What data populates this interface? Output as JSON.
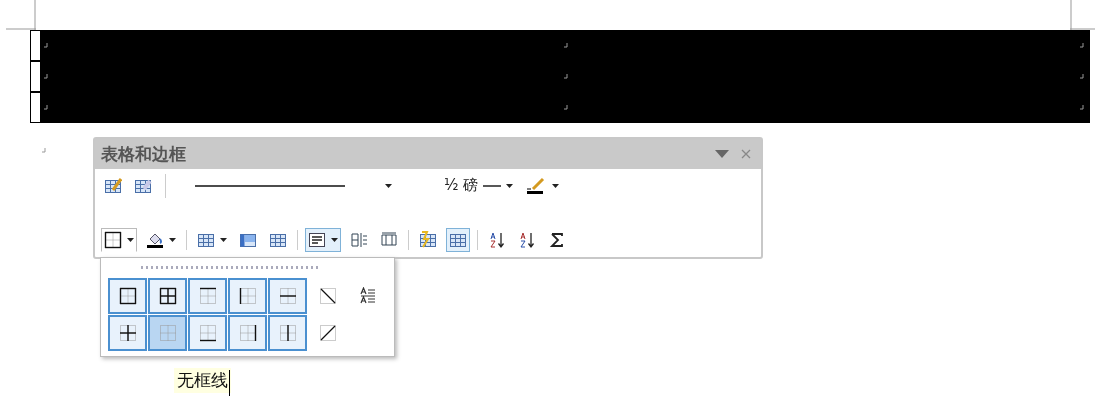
{
  "document": {
    "table": {
      "selected": true
    }
  },
  "toolbar": {
    "title": "表格和边框",
    "row_1": [
      {
        "kind": "button",
        "selected": false
      },
      {
        "kind": "button",
        "selected": false
      },
      {
        "kind": "line_style"
      },
      {
        "kind": "line_weight",
        "label": "½ 磅"
      },
      {
        "kind": "color"
      }
    ],
    "row_2": [
      {
        "kind": "dropdown",
        "selected": true
      },
      {
        "kind": "dropdown",
        "selected": false
      },
      {
        "kind": "separator"
      },
      {
        "kind": "dropdown",
        "selected": false
      },
      {
        "kind": "button",
        "selected": false
      },
      {
        "kind": "button",
        "selected": false
      },
      {
        "kind": "separator"
      },
      {
        "kind": "dropdown",
        "selected": true
      },
      {
        "kind": "button",
        "selected": false
      },
      {
        "kind": "button",
        "selected": false
      },
      {
        "kind": "separator"
      },
      {
        "kind": "button",
        "selected": false
      },
      {
        "kind": "button",
        "selected": true
      },
      {
        "kind": "separator"
      },
      {
        "kind": "button",
        "selected": false
      },
      {
        "kind": "button",
        "selected": false
      },
      {
        "kind": "button",
        "selected": false
      }
    ]
  },
  "borders_menu": {
    "items": [
      {
        "selected": true,
        "highlighted": false
      },
      {
        "selected": true,
        "highlighted": false
      },
      {
        "selected": true,
        "highlighted": false
      },
      {
        "selected": true,
        "highlighted": false
      },
      {
        "selected": true,
        "highlighted": false
      },
      {
        "selected": false,
        "highlighted": false
      },
      {
        "selected": false,
        "highlighted": false
      },
      {
        "selected": true,
        "highlighted": false
      },
      {
        "selected": true,
        "highlighted": true
      },
      {
        "selected": true,
        "highlighted": false
      },
      {
        "selected": true,
        "highlighted": false
      },
      {
        "selected": true,
        "highlighted": false
      },
      {
        "selected": false,
        "highlighted": false
      }
    ]
  },
  "tooltip": {
    "text": "无框线"
  }
}
